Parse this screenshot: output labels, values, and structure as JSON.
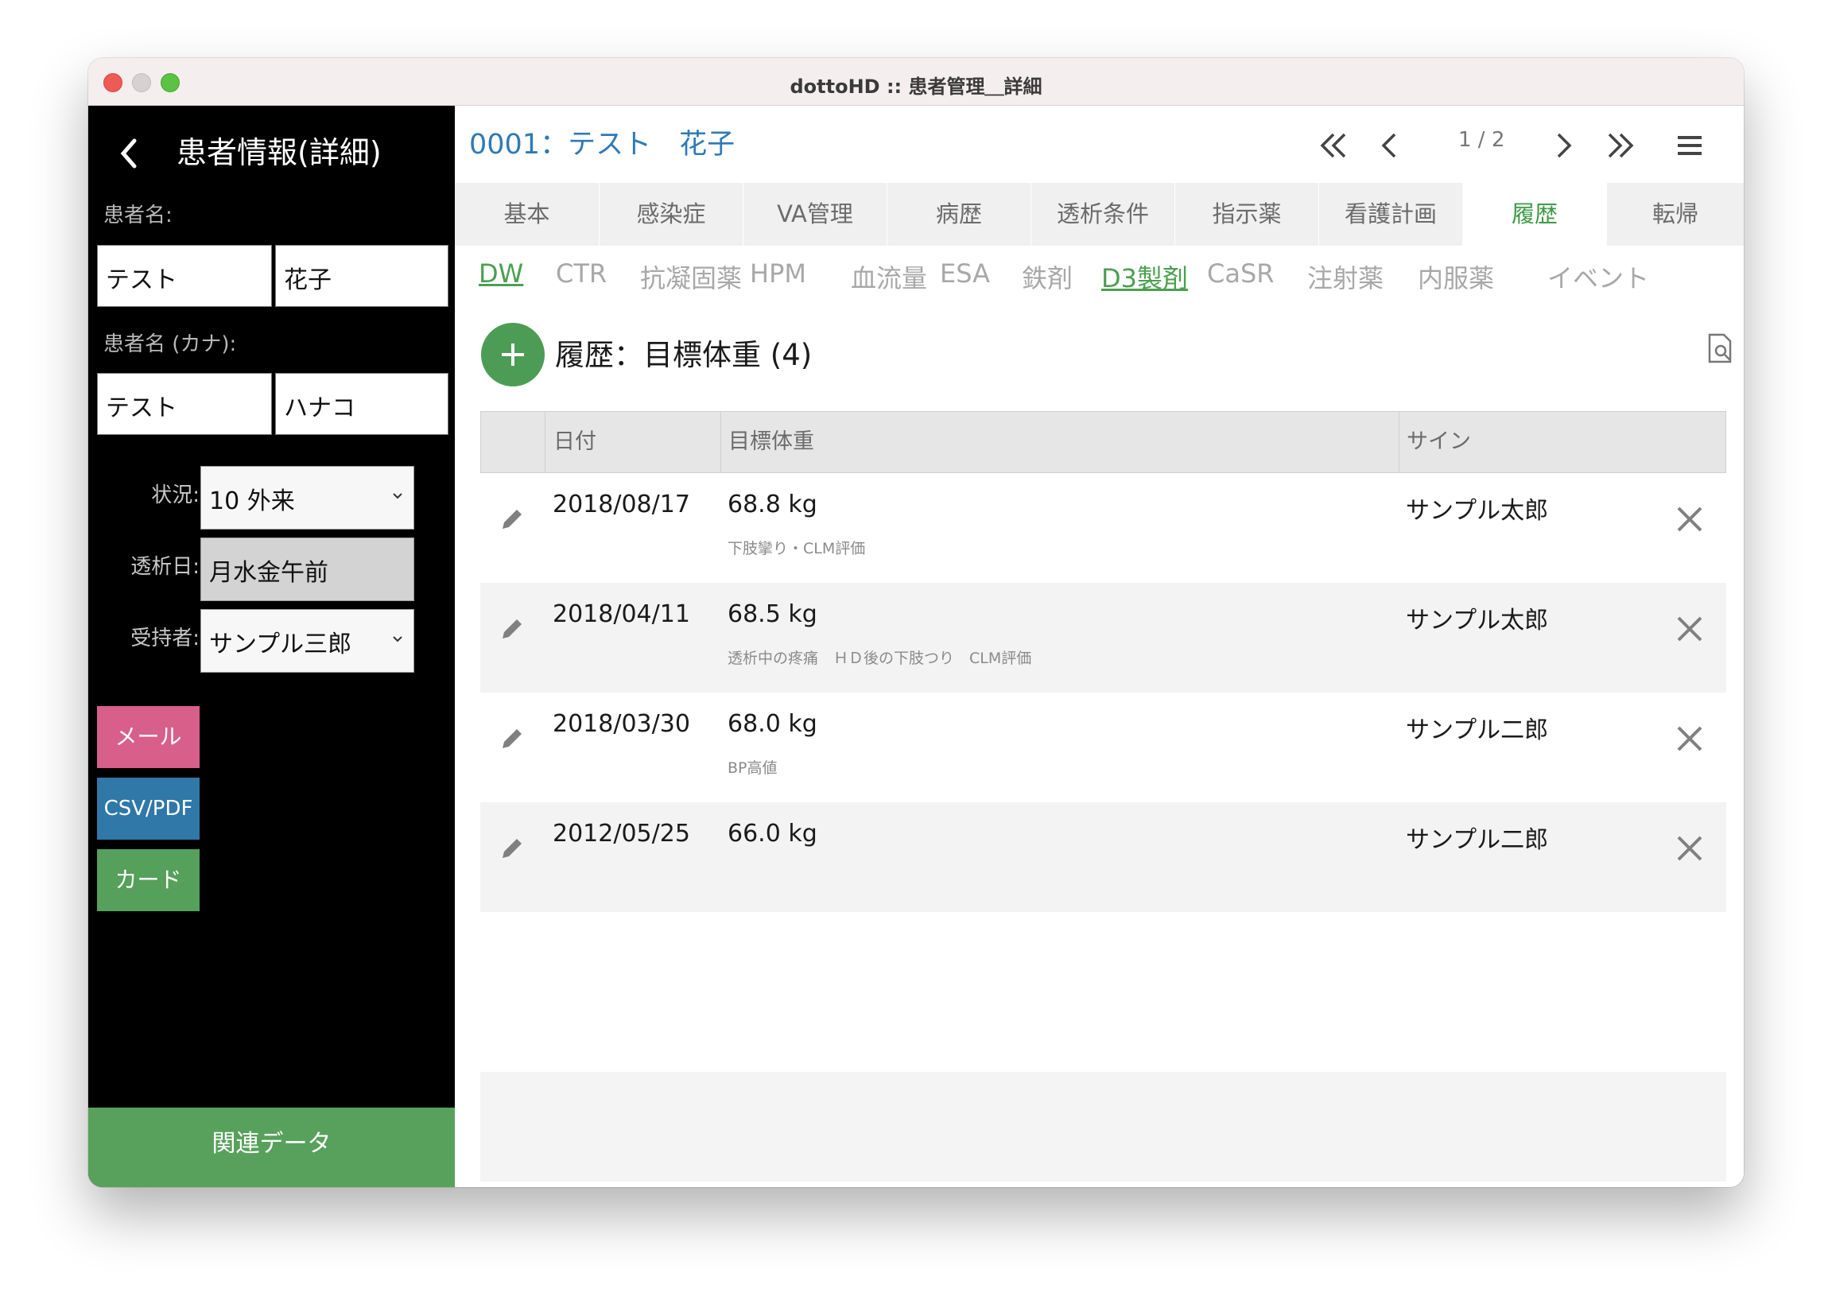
{
  "window": {
    "title": "dottoHD :: 患者管理＿詳細"
  },
  "sidebar": {
    "title": "患者情報(詳細)",
    "name_label": "患者名:",
    "last_name": "テスト",
    "first_name": "花子",
    "kana_label": "患者名 (カナ):",
    "last_kana": "テスト",
    "first_kana": "ハナコ",
    "status_label": "状況:",
    "status_value": "10 外来",
    "dialysis_day_label": "透析日:",
    "dialysis_day_value": "月水金午前",
    "receiver_label": "受持者:",
    "receiver_value": "サンプル三郎",
    "mail_button": "メール",
    "csv_button": "CSV/PDF",
    "card_button": "カード",
    "related_button": "関連データ",
    "colors": {
      "mail": "#d85f8a",
      "csv": "#2f78a8",
      "card": "#55a05a",
      "related": "#58a15c"
    }
  },
  "header": {
    "patient": "0001：テスト　花子",
    "page_indicator": "1 / 2"
  },
  "tabs": [
    "基本",
    "感染症",
    "VA管理",
    "病歴",
    "透析条件",
    "指示薬",
    "看護計画",
    "履歴",
    "転帰"
  ],
  "active_tab": "履歴",
  "subtabs": [
    "DW",
    "CTR",
    "抗凝固薬",
    "HPM",
    "血流量",
    "ESA",
    "鉄剤",
    "D3製剤",
    "CaSR",
    "注射薬",
    "内服薬",
    "イベント"
  ],
  "section": {
    "title": "履歴：目標体重 (4)"
  },
  "table": {
    "headers": {
      "date": "日付",
      "target": "目標体重",
      "sign": "サイン"
    },
    "rows": [
      {
        "date": "2018/08/17",
        "weight": "68.8 kg",
        "note": "下肢攣り・CLM評価",
        "sign": "サンプル太郎"
      },
      {
        "date": "2018/04/11",
        "weight": "68.5 kg",
        "note": "透析中の疼痛　ＨＤ後の下肢つり　CLM評価",
        "sign": "サンプル太郎"
      },
      {
        "date": "2018/03/30",
        "weight": "68.0 kg",
        "note": "BP高値",
        "sign": "サンプル二郎"
      },
      {
        "date": "2012/05/25",
        "weight": "66.0 kg",
        "note": "",
        "sign": "サンプル二郎"
      }
    ]
  },
  "accent": {
    "green": "#4c9c55",
    "blue": "#2f7ab7"
  }
}
